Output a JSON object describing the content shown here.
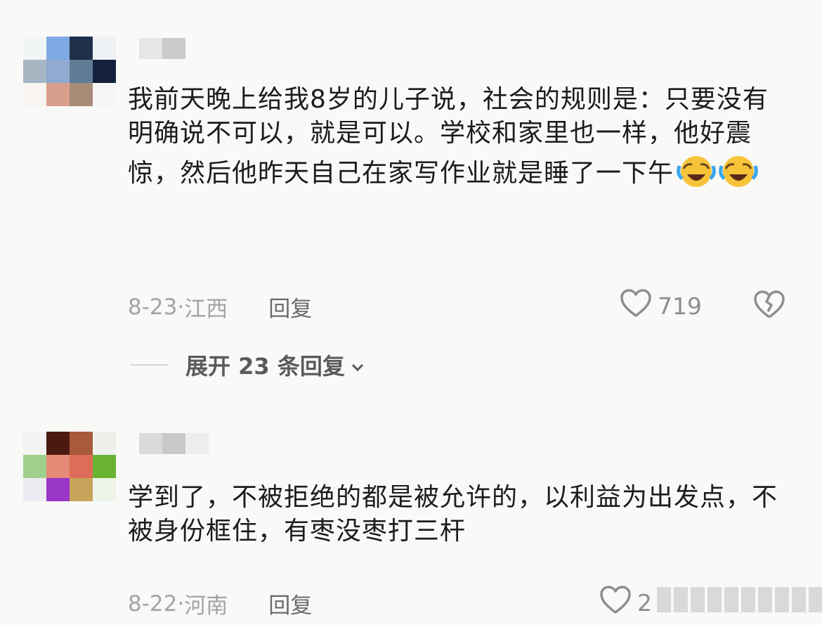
{
  "comments": [
    {
      "text": "我前天晚上给我8岁的儿子说，社会的规则是：只要没有明确说不可以，就是可以。学校和家里也一样，他好震惊，然后他昨天自己在家写作业就是睡了一下午",
      "emoji": "rolling-on-floor-laughing-icon",
      "date": "8-23·",
      "location": "江西",
      "reply_label": "回复",
      "likes": "719",
      "expand_label": "展开 23 条回复"
    },
    {
      "text": "学到了，不被拒绝的都是被允许的，以利益为出发点，不被身份框住，有枣没枣打三杆",
      "date": "8-22·",
      "location": "河南",
      "reply_label": "回复",
      "likes": "2"
    }
  ],
  "colors": {
    "background": "#f9f9f8",
    "text": "#1c1c1c",
    "meta": "#a3a3a3",
    "emoji_face": "#f7c33a",
    "emoji_tears": "#3aa6f0"
  }
}
